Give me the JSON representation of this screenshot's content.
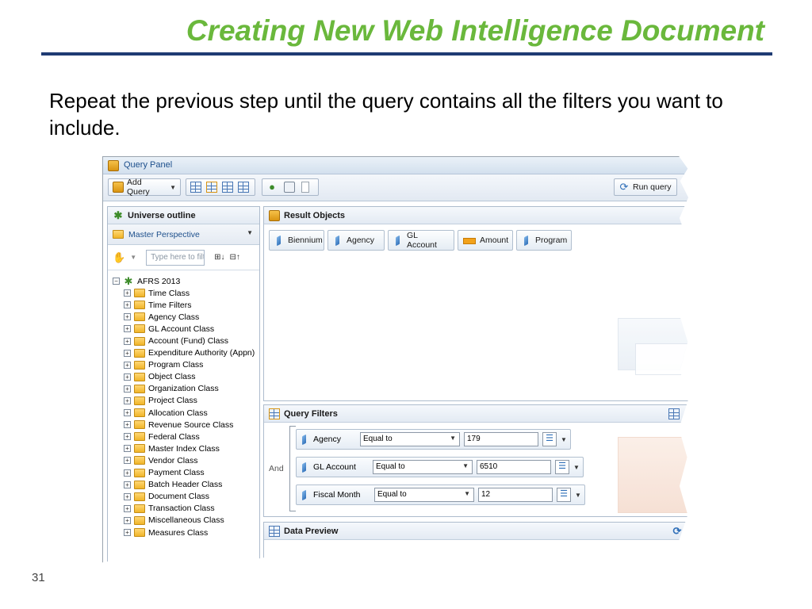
{
  "slide": {
    "title": "Creating New Web Intelligence Document",
    "body": "Repeat the previous step until the query contains all the filters you want to include.",
    "page_number": "31"
  },
  "query_panel": {
    "title": "Query Panel",
    "add_query_label": "Add Query",
    "run_query_label": "Run query"
  },
  "universe_outline": {
    "heading": "Universe outline",
    "perspective": "Master Perspective",
    "search_placeholder": "Type here to filt",
    "root": "AFRS 2013",
    "classes": [
      "Time Class",
      "Time Filters",
      "Agency Class",
      "GL Account Class",
      "Account (Fund) Class",
      "Expenditure Authority (Appn)",
      "Program Class",
      "Object Class",
      "Organization Class",
      "Project Class",
      "Allocation Class",
      "Revenue Source Class",
      "Federal Class",
      "Master Index Class",
      "Vendor Class",
      "Payment Class",
      "Batch Header Class",
      "Document Class",
      "Transaction Class",
      "Miscellaneous Class",
      "Measures Class"
    ]
  },
  "result_objects": {
    "heading": "Result Objects",
    "items": [
      {
        "label": "Biennium",
        "icon": "dimension-icon"
      },
      {
        "label": "Agency",
        "icon": "dimension-icon"
      },
      {
        "label": "GL Account",
        "icon": "dimension-icon"
      },
      {
        "label": "Amount",
        "icon": "measure-icon"
      },
      {
        "label": "Program",
        "icon": "dimension-icon"
      }
    ]
  },
  "query_filters": {
    "heading": "Query Filters",
    "operator_label": "And",
    "rows": [
      {
        "field": "Agency",
        "operator": "Equal to",
        "value": "179"
      },
      {
        "field": "GL Account",
        "operator": "Equal to",
        "value": "6510"
      },
      {
        "field": "Fiscal Month",
        "operator": "Equal to",
        "value": "12"
      }
    ]
  },
  "data_preview": {
    "heading": "Data Preview"
  },
  "colors": {
    "title_green": "#6ab83c",
    "rule_navy": "#1f3b73",
    "panel_border": "#aebccd"
  }
}
